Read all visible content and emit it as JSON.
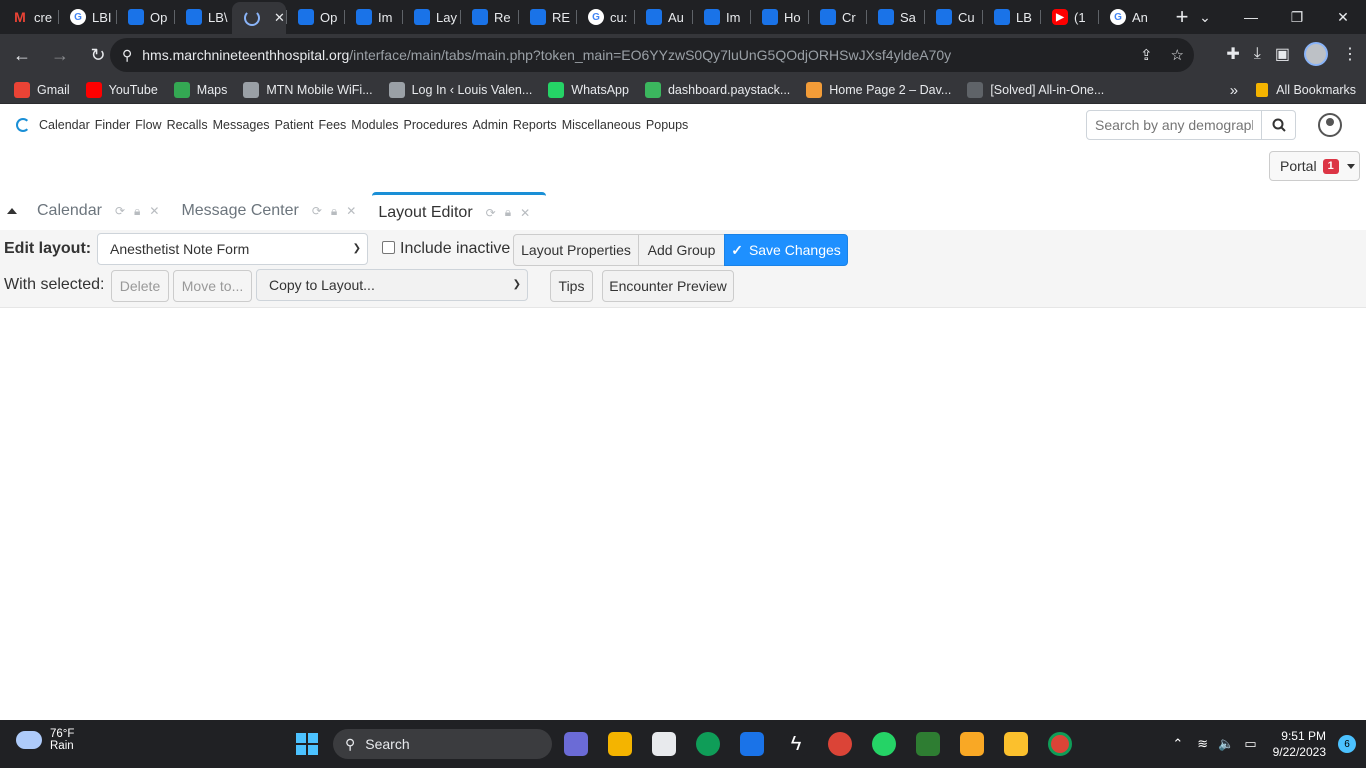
{
  "browser": {
    "tabs": [
      {
        "label": "cre",
        "icon": "gmail-icon"
      },
      {
        "label": "LBI",
        "icon": "google-icon"
      },
      {
        "label": "Op",
        "icon": "openemr-icon"
      },
      {
        "label": "LB\\",
        "icon": "openemr-icon"
      },
      {
        "label": "",
        "icon": "loading-icon",
        "active": true
      },
      {
        "label": "Op",
        "icon": "openemr-icon"
      },
      {
        "label": "Im",
        "icon": "openemr-icon"
      },
      {
        "label": "Lay",
        "icon": "openemr-icon"
      },
      {
        "label": "Re",
        "icon": "openemr-icon"
      },
      {
        "label": "RE",
        "icon": "openemr-icon"
      },
      {
        "label": "cu:",
        "icon": "google-icon"
      },
      {
        "label": "Au",
        "icon": "openemr-icon"
      },
      {
        "label": "Im",
        "icon": "openemr-icon"
      },
      {
        "label": "Ho",
        "icon": "openemr-icon"
      },
      {
        "label": "Cr",
        "icon": "openemr-icon"
      },
      {
        "label": "Sa",
        "icon": "openemr-icon"
      },
      {
        "label": "Cu",
        "icon": "openemr-icon"
      },
      {
        "label": "LB",
        "icon": "openemr-icon"
      },
      {
        "label": "(1",
        "icon": "youtube-icon"
      },
      {
        "label": "An",
        "icon": "google-icon"
      }
    ],
    "url_host": "hms.marchnineteenthhospital.org",
    "url_path": "/interface/main/tabs/main.php?token_main=EO6YYzwS0Qy7luUnG5QOdjORHSwJXsf4yldeA70y",
    "bookmarks": [
      {
        "label": "Gmail",
        "color": "#ea4335"
      },
      {
        "label": "YouTube",
        "color": "#ff0000"
      },
      {
        "label": "Maps",
        "color": "#34a853"
      },
      {
        "label": "MTN Mobile WiFi...",
        "color": "#9aa0a6"
      },
      {
        "label": "Log In ‹ Louis Valen...",
        "color": "#9aa0a6"
      },
      {
        "label": "WhatsApp",
        "color": "#25d366"
      },
      {
        "label": "dashboard.paystack...",
        "color": "#3bb75e"
      },
      {
        "label": "Home Page 2 – Dav...",
        "color": "#f29c38"
      },
      {
        "label": "[Solved] All-in-One...",
        "color": "#5f6368"
      }
    ],
    "bookmarks_overflow": "»",
    "all_bookmarks": "All Bookmarks"
  },
  "app": {
    "menu": [
      "Calendar",
      "Finder",
      "Flow",
      "Recalls",
      "Messages",
      "Patient",
      "Fees",
      "Modules",
      "Procedures",
      "Admin",
      "Reports",
      "Miscellaneous",
      "Popups"
    ],
    "search_placeholder": "Search by any demographics",
    "portal_label": "Portal",
    "portal_badge": "1",
    "tabs": [
      {
        "label": "Calendar",
        "active": false
      },
      {
        "label": "Message Center",
        "active": false
      },
      {
        "label": "Layout Editor",
        "active": true
      }
    ]
  },
  "editor": {
    "edit_layout_label": "Edit layout:",
    "layout_value": "Anesthetist Note Form",
    "include_inactive": "Include inactive",
    "layout_properties": "Layout Properties",
    "add_group": "Add Group",
    "save_changes": "Save Changes",
    "with_selected": "With selected:",
    "delete": "Delete",
    "move_to": "Move to...",
    "copy_to_layout": "Copy to Layout...",
    "tips": "Tips",
    "encounter_preview": "Encounter Preview"
  },
  "taskbar": {
    "temp": "76°F",
    "weather": "Rain",
    "search": "Search",
    "time": "9:51 PM",
    "date": "9/22/2023",
    "notifications": "6"
  },
  "colors": {
    "accent": "#1e90ff",
    "badge": "#dc3545"
  }
}
